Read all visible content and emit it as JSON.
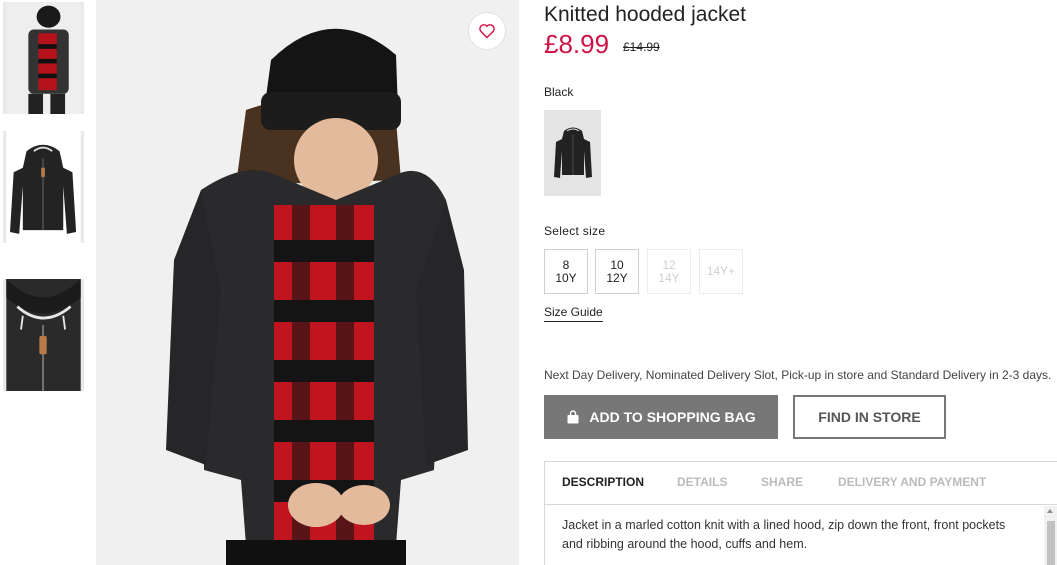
{
  "product": {
    "title": "Knitted hooded jacket",
    "price": "£8.99",
    "old_price": "£14.99",
    "color_label": "Black"
  },
  "size": {
    "label": "Select size",
    "options": [
      {
        "line1": "8",
        "line2": "10Y",
        "available": true
      },
      {
        "line1": "10",
        "line2": "12Y",
        "available": true
      },
      {
        "line1": "12",
        "line2": "14Y",
        "available": false
      },
      {
        "line1": "14Y+",
        "line2": "",
        "available": false
      }
    ],
    "guide": "Size Guide"
  },
  "delivery": {
    "info": "Next Day Delivery, Nominated Delivery Slot, Pick-up in store and Standard Delivery in 2-3 days."
  },
  "actions": {
    "add_to_bag": "ADD TO SHOPPING BAG",
    "find_in_store": "FIND IN STORE"
  },
  "tabs": [
    {
      "label": "DESCRIPTION",
      "active": true
    },
    {
      "label": "DETAILS",
      "active": false
    },
    {
      "label": "SHARE",
      "active": false
    },
    {
      "label": "DELIVERY AND PAYMENT",
      "active": false
    }
  ],
  "description": {
    "text": "Jacket in a marled cotton knit with a lined hood, zip down the front, front pockets and ribbing around the hood, cuffs and hem."
  },
  "colors": {
    "price_red": "#d01345",
    "button_gray": "#777777",
    "favorite_heart": "#d01345"
  },
  "icons": {
    "favorite": "heart-outline-icon",
    "bag": "shopping-bag-icon"
  }
}
